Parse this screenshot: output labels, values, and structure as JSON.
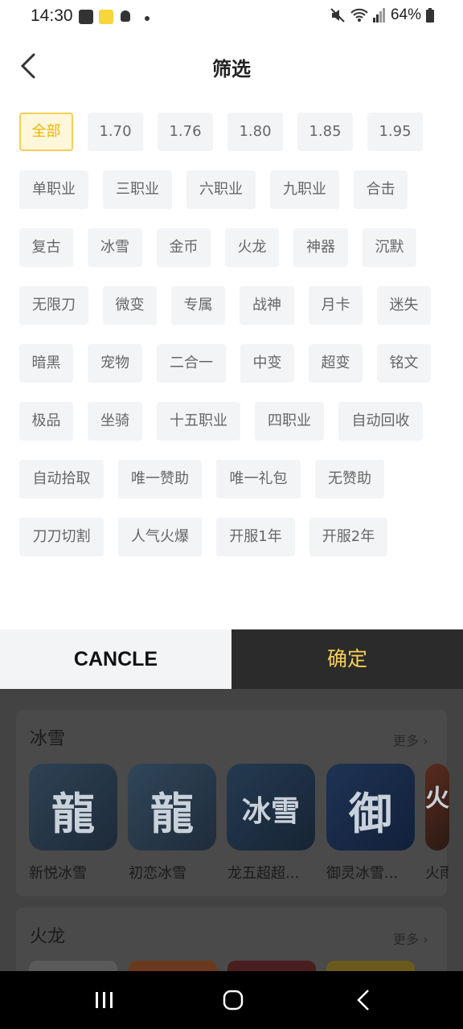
{
  "status_bar": {
    "time": "14:30",
    "battery": "64%",
    "icons": [
      "gallery-icon",
      "app-notification-icon",
      "bulb-icon",
      "dot-icon",
      "mute-icon",
      "wifi-icon",
      "signal-icon",
      "battery-icon"
    ]
  },
  "header": {
    "title": "筛选",
    "back_icon": "chevron-left-icon"
  },
  "filters": {
    "selected": "全部",
    "rows": [
      [
        "全部",
        "1.70",
        "1.76",
        "1.80",
        "1.85",
        "1.95"
      ],
      [
        "单职业",
        "三职业",
        "六职业",
        "九职业",
        "合击"
      ],
      [
        "复古",
        "冰雪",
        "金币",
        "火龙",
        "神器",
        "沉默"
      ],
      [
        "无限刀",
        "微变",
        "专属",
        "战神",
        "月卡",
        "迷失"
      ],
      [
        "暗黑",
        "宠物",
        "二合一",
        "中变",
        "超变",
        "铭文"
      ],
      [
        "极品",
        "坐骑",
        "十五职业",
        "四职业",
        "自动回收"
      ],
      [
        "自动拾取",
        "唯一赞助",
        "唯一礼包",
        "无赞助"
      ],
      [
        "刀刀切割",
        "人气火爆",
        "开服1年",
        "开服2年"
      ]
    ]
  },
  "actions": {
    "cancel_label": "CANCLE",
    "confirm_label": "确定"
  },
  "background_content": {
    "sections": [
      {
        "title": "冰雪",
        "more": "更多",
        "games": [
          {
            "name": "新悦冰雪",
            "glyph": "龍"
          },
          {
            "name": "初恋冰雪",
            "glyph": "龍"
          },
          {
            "name": "龙五超超...",
            "glyph": "冰雪"
          },
          {
            "name": "御灵冰雪...",
            "glyph": "御"
          },
          {
            "name": "火雨",
            "glyph": "火"
          }
        ]
      },
      {
        "title": "火龙",
        "more": "更多",
        "games": []
      }
    ]
  },
  "colors": {
    "accent": "#f5cf55",
    "chip_bg": "#f3f4f6",
    "chip_text": "#666666",
    "confirm_bg": "#2b2b2b",
    "overlay": "#434343"
  }
}
